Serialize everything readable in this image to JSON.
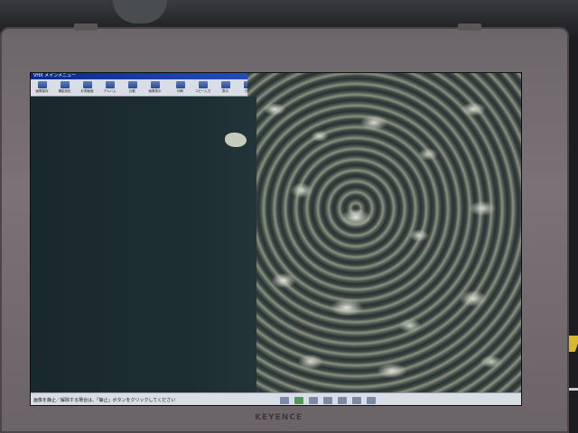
{
  "window": {
    "title": "VHX メインメニュー"
  },
  "toolbar": {
    "buttons": [
      {
        "label": "画像保存",
        "icon": "save-image-icon"
      },
      {
        "label": "撮影設定",
        "icon": "camera-settings-icon"
      },
      {
        "label": "計測画面",
        "icon": "measure-icon"
      },
      {
        "label": "アルバム",
        "icon": "album-icon"
      },
      {
        "label": "比較",
        "icon": "compare-icon"
      },
      {
        "label": "画像表示",
        "icon": "view-image-icon"
      },
      {
        "label": "印刷",
        "icon": "print-icon"
      },
      {
        "label": "コピー入力",
        "icon": "copy-input-icon"
      },
      {
        "label": "表示",
        "icon": "display-icon"
      },
      {
        "label": "分割",
        "icon": "split-icon"
      },
      {
        "label": "ズーム",
        "icon": "zoom-icon"
      },
      {
        "label": "カメラ調整",
        "icon": "camera-adjust-icon"
      },
      {
        "label": "オプション",
        "icon": "options-icon"
      },
      {
        "label": "取扱ガイド",
        "icon": "guide-icon"
      }
    ]
  },
  "status": {
    "message": "画像を静止／解除する場合は、「静止」ボタンをクリックしてください"
  },
  "monitor": {
    "brand": "KEYENCE"
  }
}
